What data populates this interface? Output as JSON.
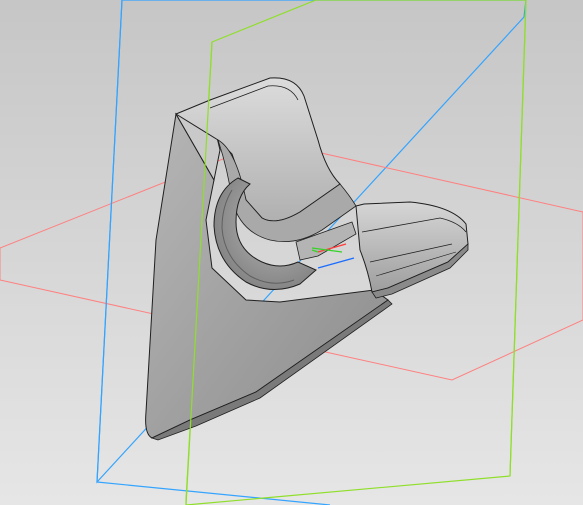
{
  "app": {
    "view": "3d-model-viewport"
  },
  "colors": {
    "background_top": "#c9c9c9",
    "background_bottom": "#e4e4e4",
    "plane_front": "#34a4ff",
    "plane_right": "#8fdf2a",
    "plane_top": "#ff7b7b",
    "part_light": "#bdbdbd",
    "part_mid": "#a8a8a8",
    "part_dark": "#8f8f8f",
    "part_edge": "#1f1f1f",
    "axis_x": "#ff3b3b",
    "axis_y": "#39d12a",
    "axis_z": "#1a6cff"
  },
  "icons": {
    "origin": "origin-axes-icon"
  }
}
